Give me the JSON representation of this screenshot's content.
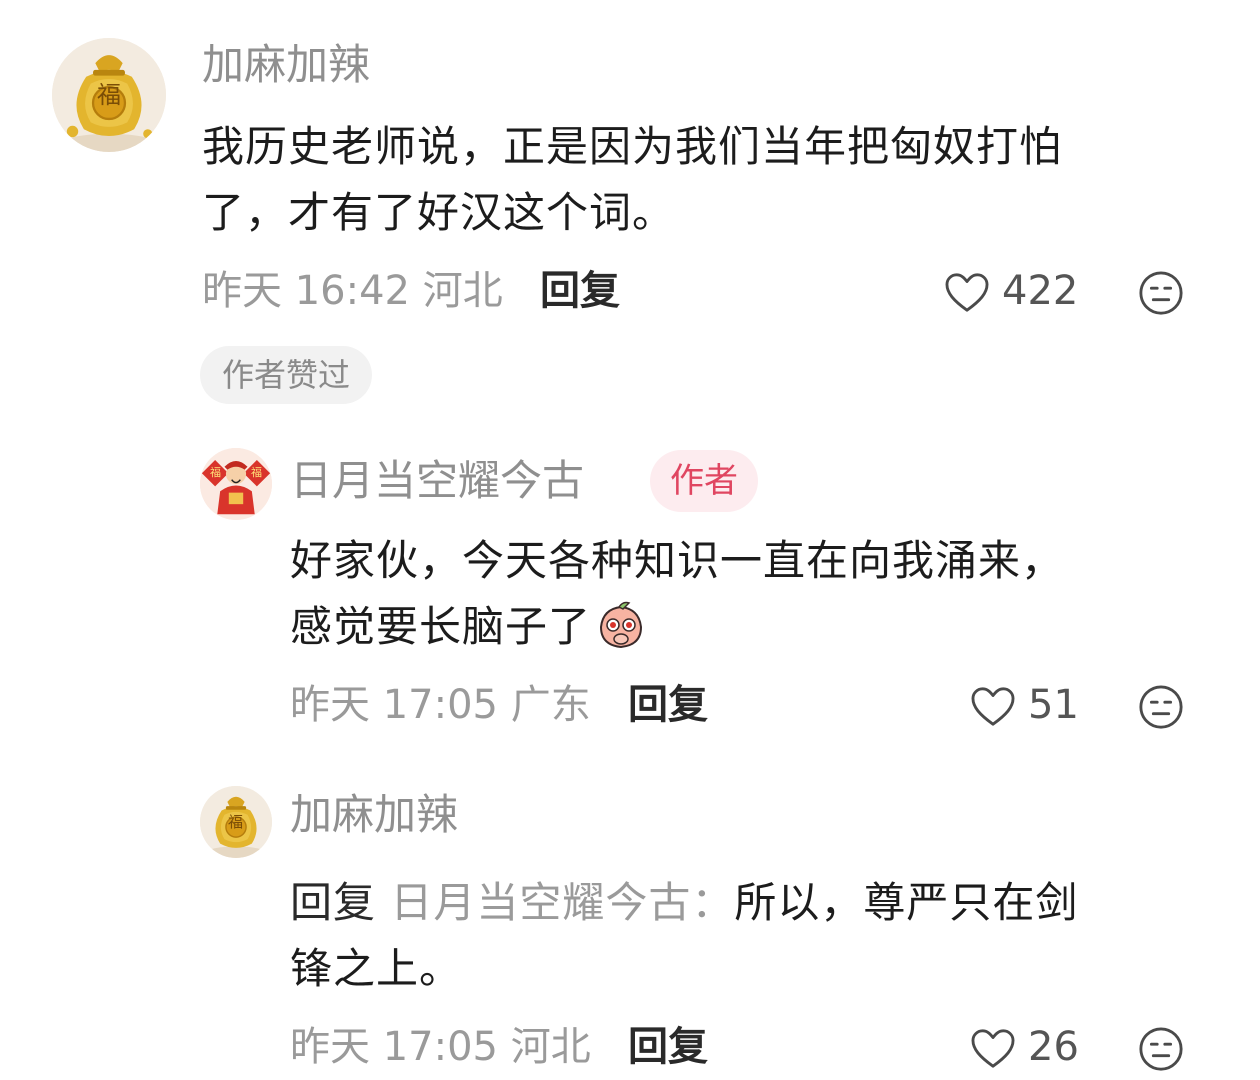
{
  "comments": [
    {
      "user": "加麻加辣",
      "text_line1": "我历史老师说，正是因为我们当年把匈奴打怕",
      "text_line2": "了，才有了好汉这个词。",
      "time": "昨天 16:42",
      "location": "河北",
      "reply_label": "回复",
      "likes": "422",
      "badge": "作者赞过",
      "avatar_char": "福"
    },
    {
      "user": "日月当空耀今古",
      "author_label": "作者",
      "text_line1": "好家伙，今天各种知识一直在向我涌来，",
      "text_line2": "感觉要长脑子了",
      "time": "昨天 17:05",
      "location": "广东",
      "reply_label": "回复",
      "likes": "51",
      "avatar_chars": [
        "福",
        "福"
      ]
    },
    {
      "user": "加麻加辣",
      "reply_prefix": "回复",
      "reply_target": "日月当空耀今古：",
      "text_line1_rest": "所以，尊严只在剑",
      "text_line2": "锋之上。",
      "time": "昨天 17:05",
      "location": "河北",
      "reply_label": "回复",
      "likes": "26",
      "avatar_char": "福"
    }
  ],
  "icons": {
    "like": "heart-outline-icon",
    "more": "neutral-face-icon",
    "emoji": "peach-emoji-icon"
  },
  "colors": {
    "author_badge_text": "#e04661",
    "author_badge_bg": "#fdecef",
    "muted_text": "#9a9a9a"
  }
}
